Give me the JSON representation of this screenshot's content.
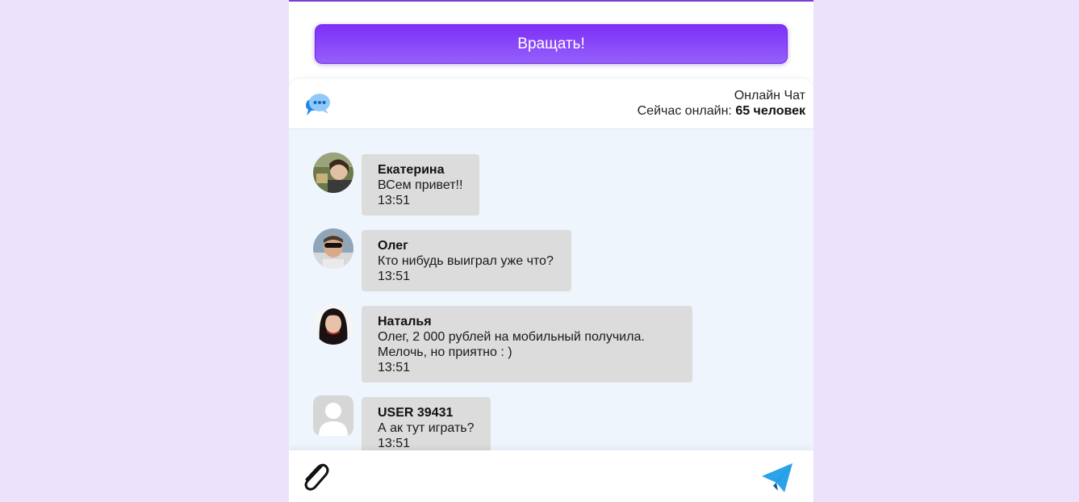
{
  "spin": {
    "label": "Вращать!"
  },
  "chat_header": {
    "title": "Онлайн Чат",
    "online_prefix": "Сейчас онлайн: ",
    "online_count": "65 человек",
    "icon": "chat-bubble-icon"
  },
  "messages": [
    {
      "author": "Екатерина",
      "lines": [
        "ВСем привет!!"
      ],
      "time": "13:51",
      "avatar": "user-photo-ekaterina"
    },
    {
      "author": "Олег",
      "lines": [
        "Кто нибудь выиграл уже что?"
      ],
      "time": "13:51",
      "avatar": "user-photo-oleg"
    },
    {
      "author": "Наталья",
      "lines": [
        "Олег, 2 000 рублей на мобильный получила.",
        "Мелочь, но приятно : )"
      ],
      "time": "13:51",
      "avatar": "user-photo-natalya"
    },
    {
      "author": "USER 39431",
      "lines": [
        "А ак тут играть?"
      ],
      "time": "13:51",
      "avatar": "default-user-icon"
    }
  ],
  "composer": {
    "input_value": "",
    "attach_icon": "paperclip-icon",
    "send_icon": "paper-plane-icon"
  },
  "colors": {
    "page_bg": "#ede2fb",
    "button_gradient_top": "#7d2ff7",
    "button_gradient_bottom": "#9560fb",
    "messages_bg": "#eef5fd",
    "bubble_bg": "#dcdcdc",
    "send_icon": "#2aa3e8"
  }
}
